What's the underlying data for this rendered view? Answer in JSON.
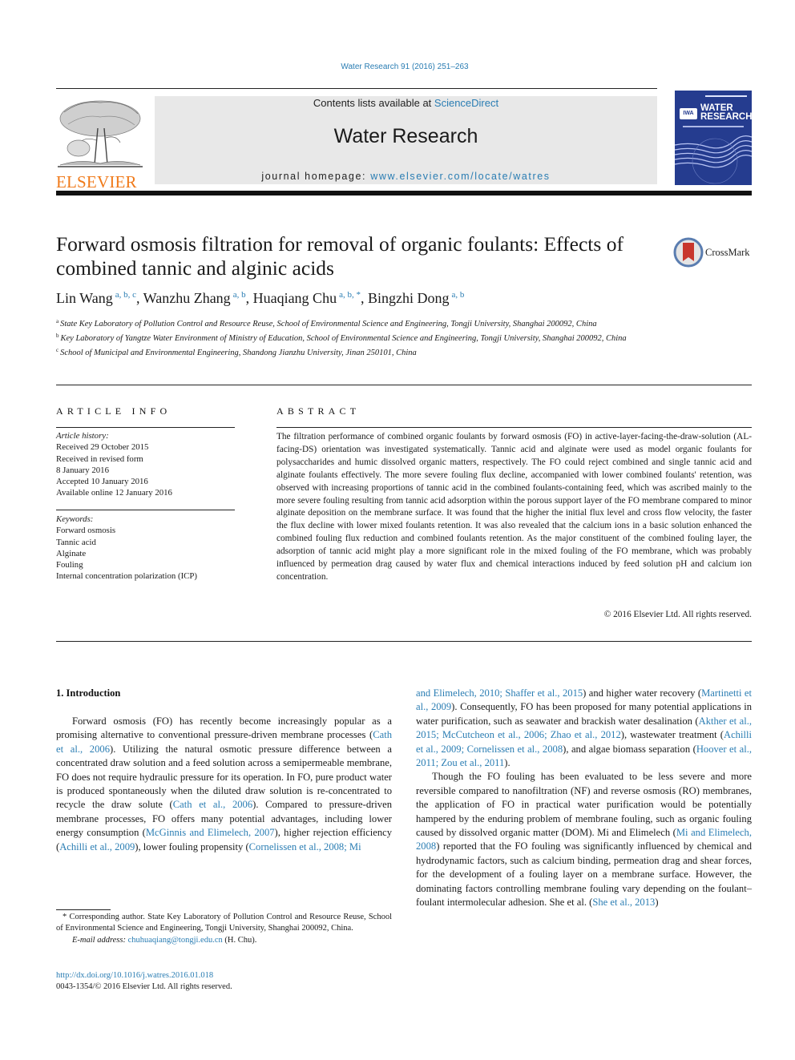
{
  "citation": "Water Research 91 (2016) 251–263",
  "header": {
    "publisher_logo_text": "ELSEVIER",
    "contents_prefix": "Contents lists available at ",
    "contents_link": "ScienceDirect",
    "journal_title": "Water Research",
    "homepage_prefix": "journal homepage: ",
    "homepage_link": "www.elsevier.com/locate/watres",
    "cover_title_line1": "WATER",
    "cover_title_line2": "RESEARCH",
    "cover_badge": "IWA"
  },
  "article": {
    "title": "Forward osmosis filtration for removal of organic foulants: Effects of combined tannic and alginic acids",
    "crossmark_label": "CrossMark",
    "authors": [
      {
        "name": "Lin Wang",
        "affil": "a, b, c"
      },
      {
        "name": "Wanzhu Zhang",
        "affil": "a, b"
      },
      {
        "name": "Huaqiang Chu",
        "affil": "a, b, *"
      },
      {
        "name": "Bingzhi Dong",
        "affil": "a, b"
      }
    ],
    "affiliations": [
      {
        "key": "a",
        "text": "State Key Laboratory of Pollution Control and Resource Reuse, School of Environmental Science and Engineering, Tongji University, Shanghai 200092, China"
      },
      {
        "key": "b",
        "text": "Key Laboratory of Yangtze Water Environment of Ministry of Education, School of Environmental Science and Engineering, Tongji University, Shanghai 200092, China"
      },
      {
        "key": "c",
        "text": "School of Municipal and Environmental Engineering, Shandong Jianzhu University, Jinan 250101, China"
      }
    ]
  },
  "article_info": {
    "heading": "ARTICLE INFO",
    "history_label": "Article history:",
    "history": [
      "Received 29 October 2015",
      "Received in revised form",
      "8 January 2016",
      "Accepted 10 January 2016",
      "Available online 12 January 2016"
    ],
    "keywords_label": "Keywords:",
    "keywords": [
      "Forward osmosis",
      "Tannic acid",
      "Alginate",
      "Fouling",
      "Internal concentration polarization (ICP)"
    ]
  },
  "abstract": {
    "heading": "ABSTRACT",
    "text": "The filtration performance of combined organic foulants by forward osmosis (FO) in active-layer-facing-the-draw-solution (AL-facing-DS) orientation was investigated systematically. Tannic acid and alginate were used as model organic foulants for polysaccharides and humic dissolved organic matters, respectively. The FO could reject combined and single tannic acid and alginate foulants effectively. The more severe fouling flux decline, accompanied with lower combined foulants' retention, was observed with increasing proportions of tannic acid in the combined foulants-containing feed, which was ascribed mainly to the more severe fouling resulting from tannic acid adsorption within the porous support layer of the FO membrane compared to minor alginate deposition on the membrane surface. It was found that the higher the initial flux level and cross flow velocity, the faster the flux decline with lower mixed foulants retention. It was also revealed that the calcium ions in a basic solution enhanced the combined fouling flux reduction and combined foulants retention. As the major constituent of the combined fouling layer, the adsorption of tannic acid might play a more significant role in the mixed fouling of the FO membrane, which was probably influenced by permeation drag caused by water flux and chemical interactions induced by feed solution pH and calcium ion concentration.",
    "copyright": "© 2016 Elsevier Ltd. All rights reserved."
  },
  "introduction": {
    "heading": "1.  Introduction",
    "paragraph1": [
      {
        "t": "Forward osmosis (FO) has recently become increasingly popular as a promising alternative to conventional pressure-driven membrane processes ("
      },
      {
        "t": "Cath et al., 2006",
        "link": true
      },
      {
        "t": "). Utilizing the natural osmotic pressure difference between a concentrated draw solution and a feed solution across a semipermeable membrane, FO does not require hydraulic pressure for its operation. In FO, pure product water is produced spontaneously when the diluted draw solution is re-concentrated to recycle the draw solute ("
      },
      {
        "t": "Cath et al., 2006",
        "link": true
      },
      {
        "t": "). Compared to pressure-driven membrane processes, FO offers many potential advantages, including lower energy consumption ("
      },
      {
        "t": "McGinnis and Elimelech, 2007",
        "link": true
      },
      {
        "t": "), higher rejection efficiency ("
      },
      {
        "t": "Achilli et al., 2009",
        "link": true
      },
      {
        "t": "), lower fouling propensity ("
      },
      {
        "t": "Cornelissen et al., 2008; Mi",
        "link": true
      }
    ],
    "paragraph1_cont": [
      {
        "t": "and Elimelech, 2010; Shaffer et al., 2015",
        "link": true
      },
      {
        "t": ") and higher water recovery ("
      },
      {
        "t": "Martinetti et al., 2009",
        "link": true
      },
      {
        "t": "). Consequently, FO has been proposed for many potential applications in water purification, such as seawater and brackish water desalination ("
      },
      {
        "t": "Akther et al., 2015; McCutcheon et al., 2006; Zhao et al., 2012",
        "link": true
      },
      {
        "t": "), wastewater treatment ("
      },
      {
        "t": "Achilli et al., 2009; Cornelissen et al., 2008",
        "link": true
      },
      {
        "t": "), and algae biomass separation ("
      },
      {
        "t": "Hoover et al., 2011; Zou et al., 2011",
        "link": true
      },
      {
        "t": ")."
      }
    ],
    "paragraph2": [
      {
        "t": "Though the FO fouling has been evaluated to be less severe and more reversible compared to nanofiltration (NF) and reverse osmosis (RO) membranes, the application of FO in practical water purification would be potentially hampered by the enduring problem of membrane fouling, such as organic fouling caused by dissolved organic matter (DOM). Mi and Elimelech ("
      },
      {
        "t": "Mi and Elimelech, 2008",
        "link": true
      },
      {
        "t": ") reported that the FO fouling was significantly influenced by chemical and hydrodynamic factors, such as calcium binding, permeation drag and shear forces, for the development of a fouling layer on a membrane surface. However, the dominating factors controlling membrane fouling vary depending on the foulant–foulant intermolecular adhesion. She et al. ("
      },
      {
        "t": "She et al., 2013",
        "link": true
      },
      {
        "t": ")"
      }
    ]
  },
  "footnote": {
    "corresponding": "* Corresponding author. State Key Laboratory of Pollution Control and Resource Reuse, School of Environmental Science and Engineering, Tongji University, Shanghai 200092, China.",
    "email_label": "E-mail address: ",
    "email": "chuhuaqiang@tongji.edu.cn",
    "email_suffix": " (H. Chu).",
    "doi": "http://dx.doi.org/10.1016/j.watres.2016.01.018",
    "issn": "0043-1354/© 2016 Elsevier Ltd. All rights reserved."
  },
  "colors": {
    "link": "#2a7db3",
    "elsevier_orange": "#f07a1a",
    "banner_gray": "#e8e8e8",
    "cover_blue": "#253c8f"
  }
}
